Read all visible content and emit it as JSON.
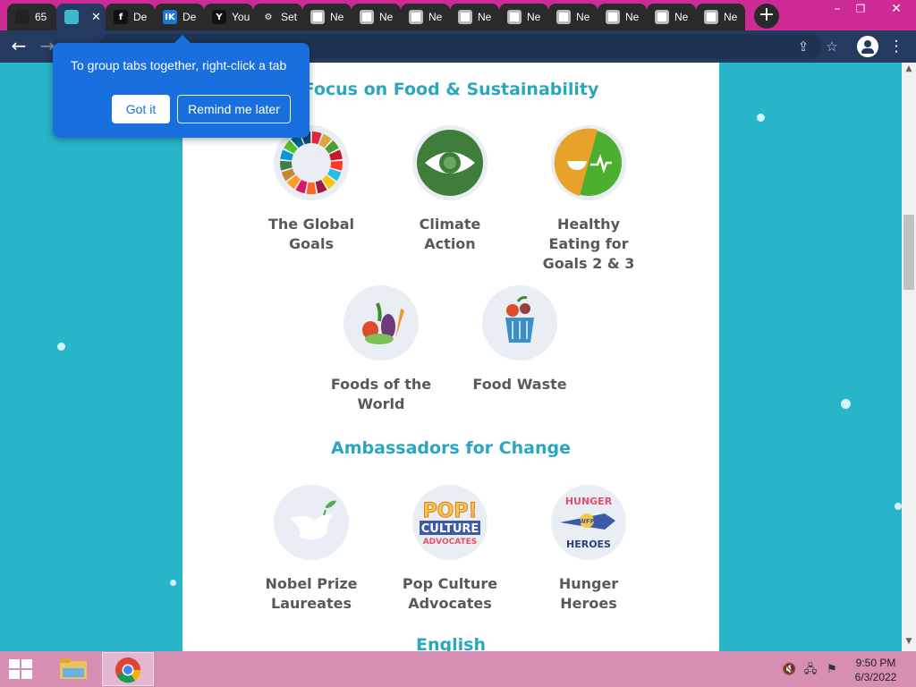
{
  "tabs": [
    {
      "icon": "books-icon",
      "title": "65",
      "fav_bg": "#222",
      "fav_text": "",
      "style": "dark"
    },
    {
      "icon": "puzzle-icon",
      "title": "",
      "fav_bg": "#3fb8c9",
      "fav_text": "",
      "style": "active",
      "close": "✕"
    },
    {
      "icon": "fandom-icon",
      "title": "De",
      "fav_bg": "#111",
      "fav_text": "f",
      "style": "dark"
    },
    {
      "icon": "ik-icon",
      "title": "De",
      "fav_bg": "#1a7bd6",
      "fav_text": "IK",
      "style": "dark"
    },
    {
      "icon": "ya-icon",
      "title": "You",
      "fav_bg": "#111",
      "fav_text": "Y",
      "style": "dark"
    },
    {
      "icon": "gear-icon",
      "title": "Set",
      "fav_bg": "transparent",
      "fav_text": "⚙",
      "style": "dark"
    },
    {
      "icon": "chrome-icon",
      "title": "Ne",
      "style": "dark"
    },
    {
      "icon": "chrome-icon",
      "title": "Ne",
      "style": "dark"
    },
    {
      "icon": "chrome-icon",
      "title": "Ne",
      "style": "dark"
    },
    {
      "icon": "chrome-icon",
      "title": "Ne",
      "style": "dark"
    },
    {
      "icon": "chrome-icon",
      "title": "Ne",
      "style": "dark"
    },
    {
      "icon": "chrome-icon",
      "title": "Ne",
      "style": "dark"
    },
    {
      "icon": "chrome-icon",
      "title": "Ne",
      "style": "dark"
    },
    {
      "icon": "chrome-icon",
      "title": "Ne",
      "style": "dark"
    },
    {
      "icon": "chrome-icon",
      "title": "Ne",
      "style": "dark"
    }
  ],
  "new_tab_label": "+",
  "window_controls": {
    "minimize": "–",
    "restore": "❐",
    "close": "✕"
  },
  "toolbar": {
    "back": "←",
    "forward": "→",
    "share": "⇪",
    "star": "☆",
    "menu": "⋮"
  },
  "popup": {
    "text": "To group tabs together, right-click a tab",
    "got_it": "Got it",
    "remind_later": "Remind me later"
  },
  "page": {
    "section1_title": "Focus on Food & Sustainability",
    "section1_items": [
      {
        "name": "global-goals",
        "line1": "The Global",
        "line2": "Goals",
        "line3": ""
      },
      {
        "name": "climate-action",
        "line1": "Climate",
        "line2": "Action",
        "line3": ""
      },
      {
        "name": "healthy-eating",
        "line1": "Healthy",
        "line2": "Eating for",
        "line3": "Goals 2 & 3"
      },
      {
        "name": "foods-of-the-world",
        "line1": "Foods of the",
        "line2": "World",
        "line3": ""
      },
      {
        "name": "food-waste",
        "line1": "Food Waste",
        "line2": "",
        "line3": ""
      }
    ],
    "section2_title": "Ambassadors for Change",
    "section2_items": [
      {
        "name": "nobel-prize-laureates",
        "line1": "Nobel Prize",
        "line2": "Laureates"
      },
      {
        "name": "pop-culture-advocates",
        "line1": "Pop Culture",
        "line2": "Advocates"
      },
      {
        "name": "hunger-heroes",
        "line1": "Hunger",
        "line2": "Heroes"
      }
    ],
    "badge_pop_culture": {
      "l1": "POP!",
      "l2": "CULTURE",
      "l3": "ADVOCATES"
    },
    "badge_hunger": {
      "l1": "HUNGER",
      "l2": "WFP",
      "l3": "HEROES"
    },
    "section3_title": "English"
  },
  "taskbar": {
    "time": "9:50 PM",
    "date": "6/3/2022"
  },
  "colors": {
    "accent_title": "#2aa7bf",
    "page_bg": "#28b4c9",
    "tabstrip": "#cc2b96",
    "popup": "#1a6fde"
  }
}
